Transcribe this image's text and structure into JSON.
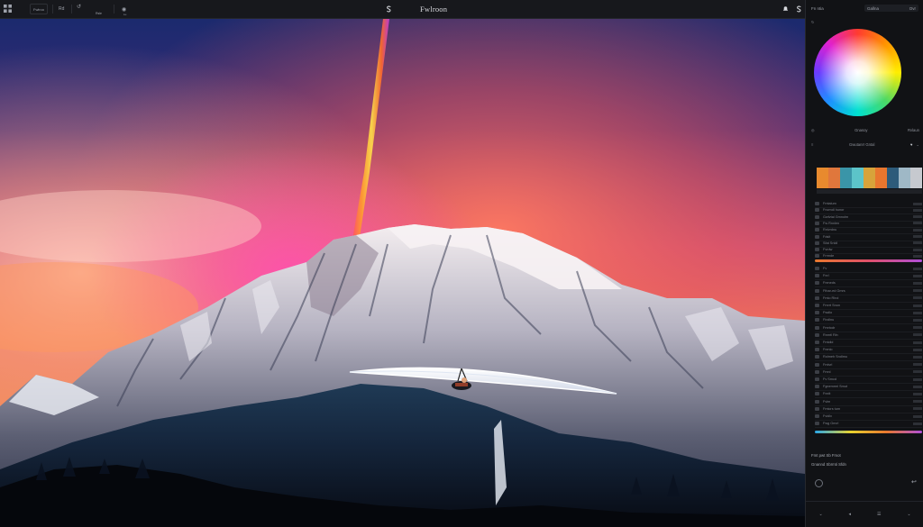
{
  "app": {
    "title": "Fwlroon"
  },
  "toolbar": {
    "items": [
      {
        "label": "Fwlroo",
        "icon": "grid-icon"
      },
      {
        "label": "Rd",
        "icon": "image-icon"
      },
      {
        "label": "Rsle",
        "icon": "undo-icon"
      },
      {
        "label": "Lu",
        "icon": "globe-icon"
      }
    ],
    "center_icon": "s-icon",
    "right_icons": [
      "bell-icon",
      "s-icon"
    ]
  },
  "panel": {
    "header": {
      "label": "Fn ntia",
      "toggle_left": "Gallna",
      "toggle_right": "Ovr"
    },
    "mode_row": {
      "left": "Gnasoy",
      "right": "Rvlaun"
    },
    "palette_row": {
      "label": "Gwutanrr Gntal",
      "icons": [
        "heart-icon",
        "chevron-down-icon"
      ]
    },
    "swatches": [
      "#e88a2e",
      "#e0773c",
      "#3a95a8",
      "#5cc4c9",
      "#d7a33a",
      "#e8762e",
      "#2d5b7a",
      "#9fb8c6",
      "#c6c9cf"
    ],
    "layers_a": [
      "Fmtalum",
      "Fnomdl hunor",
      "Gwfvtal Gmnolrn",
      "Fw Rnnlen",
      "Rnlvrdnu",
      "Fdslt",
      "Sfat Snldl",
      "Fvrdw",
      "Frrmde"
    ],
    "layers_b": [
      "Fv",
      "Fnrl",
      "Fnmeds",
      "Fthar-ed Gmrs",
      "Fmlo Rlrol",
      "Fmrrt Snon",
      "Fwdlo",
      "Fivdlnu",
      "Fmrtodr",
      "Rnmtl Rln",
      "Fmldid",
      "Fnmlo",
      "Rolmeh Sndlmu",
      "Fmlvrl",
      "Fmnl",
      "Fv Smcd",
      "Fgnemrml Smut",
      "Fnnlt",
      "Fvlm",
      "Fmtcrs tum",
      "Fvidlx",
      "Fwg Gnvrl"
    ],
    "footer_line1": "Fmt pwt Sb Fmot",
    "footer_line2": "Gnannd Sbrmti Sfdn",
    "bottom": [
      "chevron-down-icon",
      "arrow-icon",
      "sliders-icon",
      "chevron-down-icon"
    ]
  },
  "colors": {
    "accent_gradient_start": "#e8782e",
    "accent_gradient_end": "#b04fd8",
    "panel_bg": "#111215"
  }
}
